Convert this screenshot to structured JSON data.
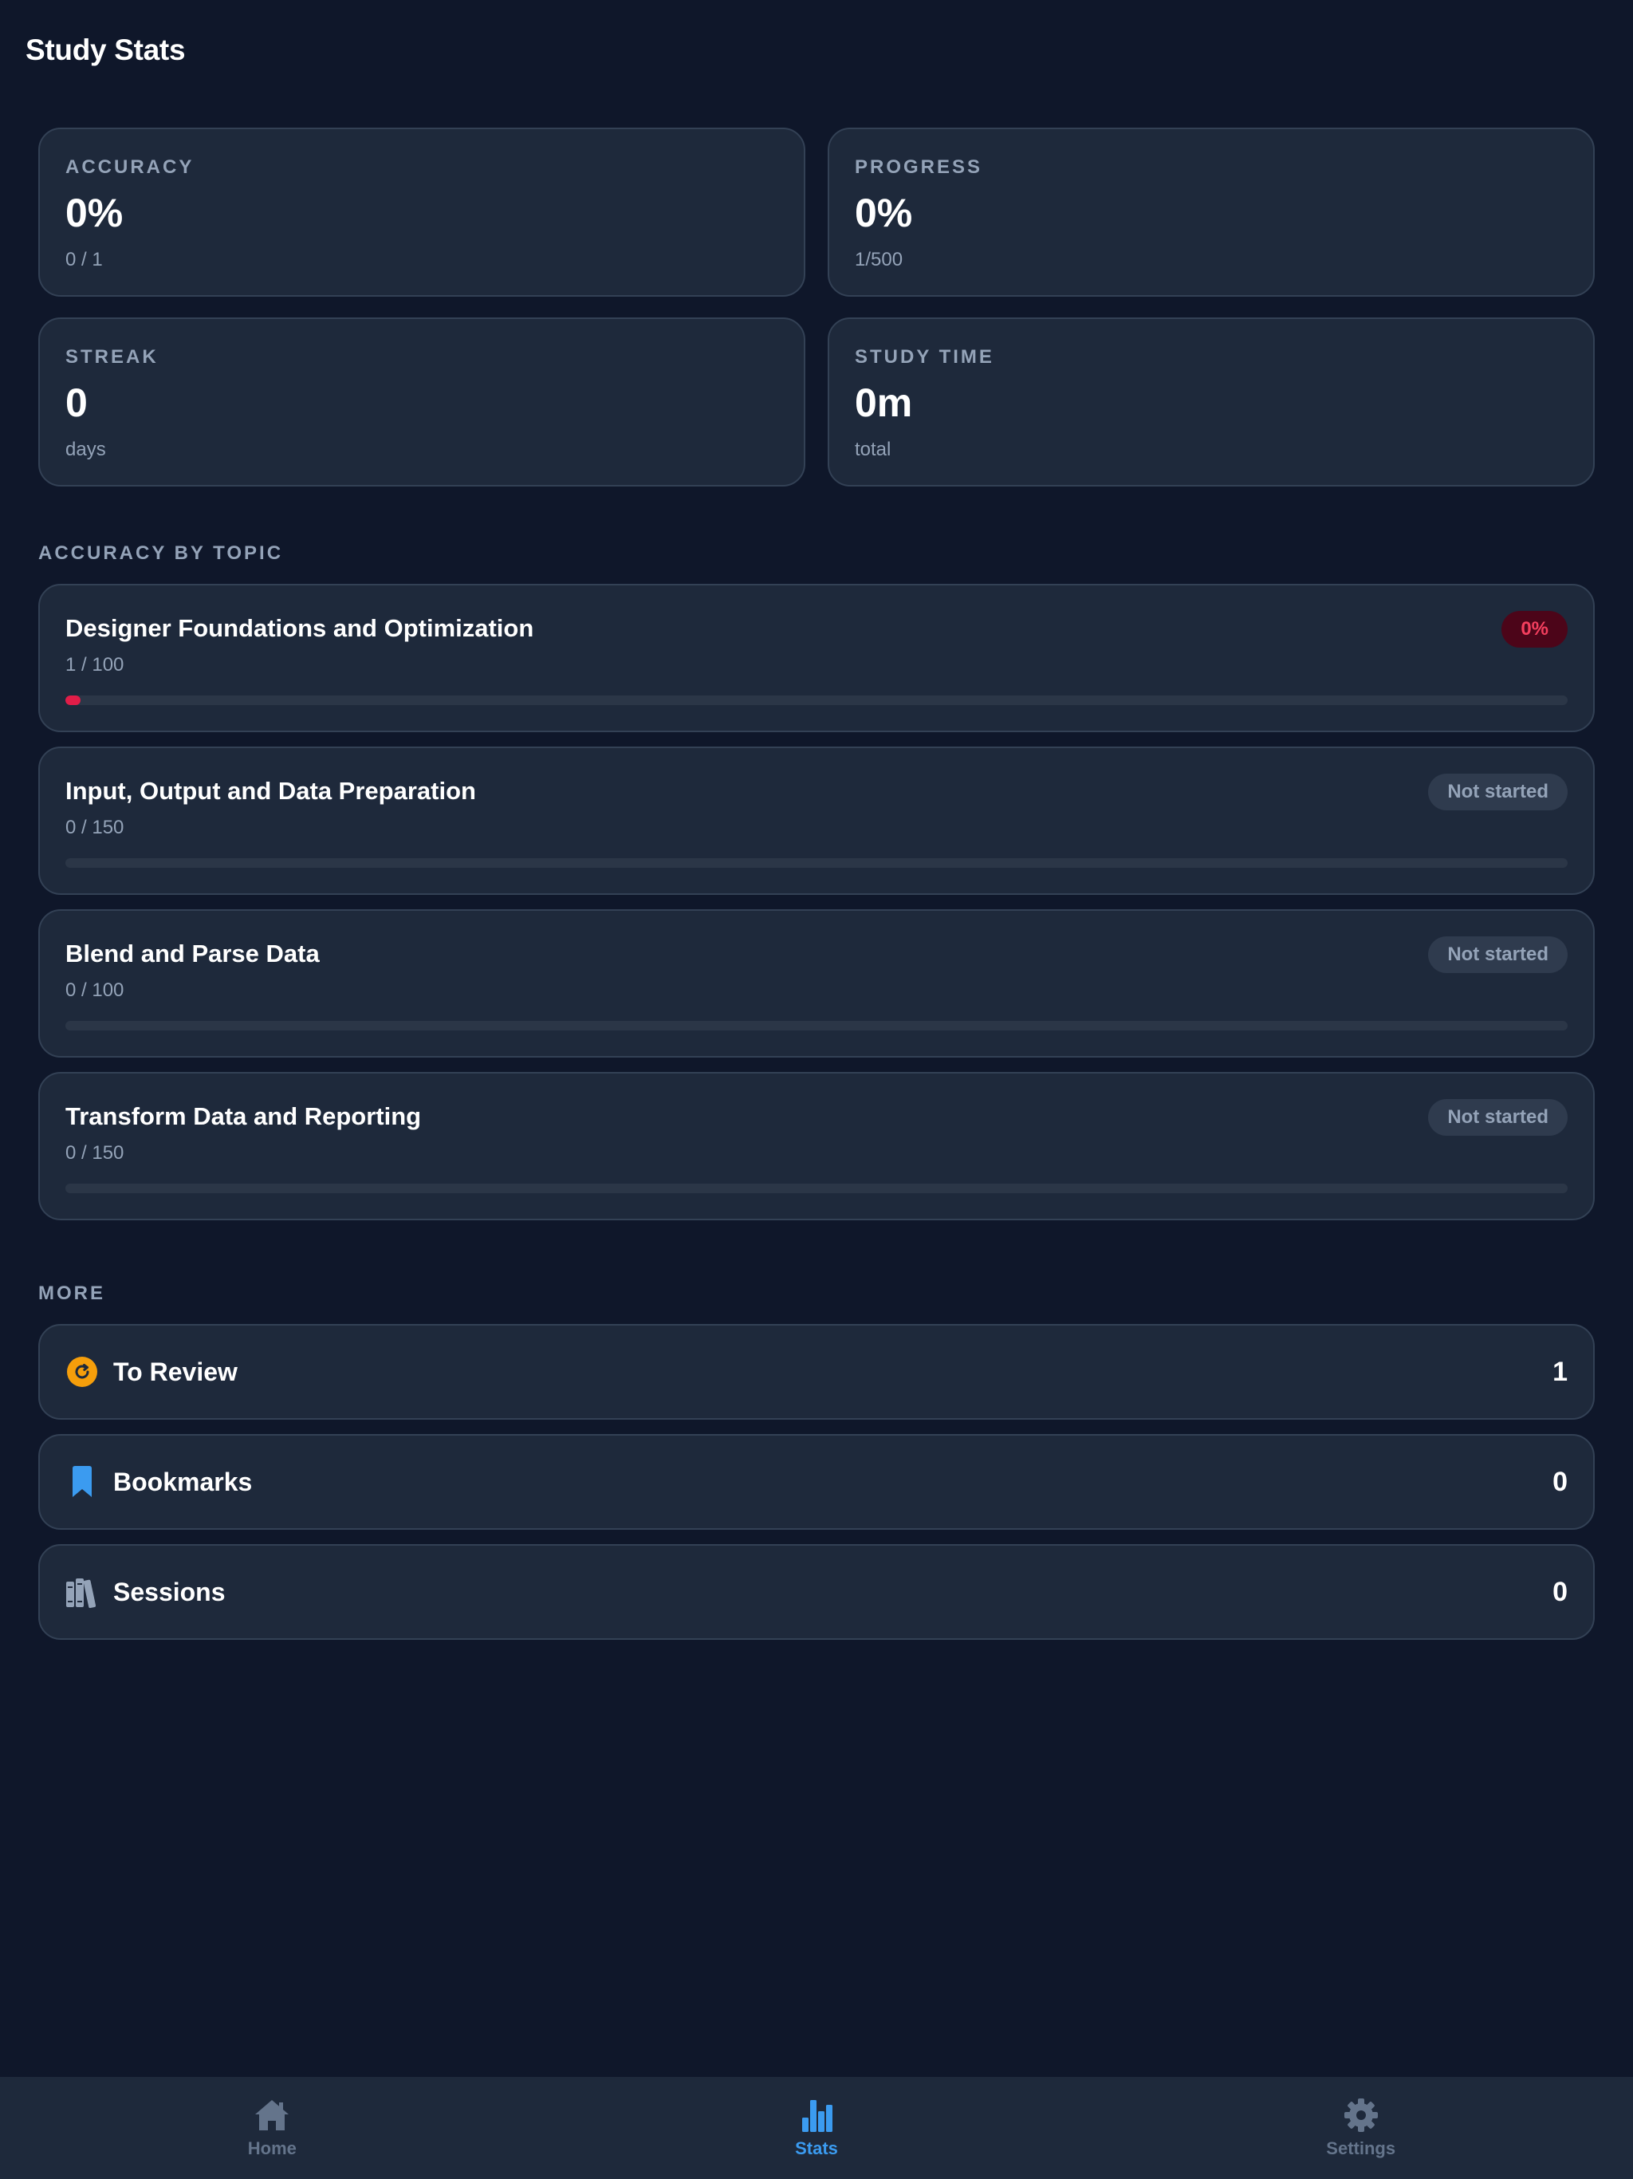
{
  "header": {
    "title": "Study Stats"
  },
  "stats": [
    {
      "label": "ACCURACY",
      "value": "0%",
      "sub": "0 / 1"
    },
    {
      "label": "PROGRESS",
      "value": "0%",
      "sub": "1/500"
    },
    {
      "label": "STREAK",
      "value": "0",
      "sub": "days"
    },
    {
      "label": "STUDY TIME",
      "value": "0m",
      "sub": "total"
    }
  ],
  "topics_section": {
    "title": "ACCURACY BY TOPIC",
    "items": [
      {
        "name": "Designer Foundations and Optimization",
        "count": "1 / 100",
        "badge": "0%",
        "progress": 0.01
      },
      {
        "name": "Input, Output and Data Preparation",
        "count": "0 / 150",
        "badge": "Not started",
        "progress": 0
      },
      {
        "name": "Blend and Parse Data",
        "count": "0 / 100",
        "badge": "Not started",
        "progress": 0
      },
      {
        "name": "Transform Data and Reporting",
        "count": "0 / 150",
        "badge": "Not started",
        "progress": 0
      }
    ]
  },
  "more_section": {
    "title": "MORE",
    "items": [
      {
        "label": "To Review",
        "count": "1",
        "icon": "refresh-icon"
      },
      {
        "label": "Bookmarks",
        "count": "0",
        "icon": "bookmark-icon"
      },
      {
        "label": "Sessions",
        "count": "0",
        "icon": "books-icon"
      }
    ]
  },
  "nav": {
    "items": [
      {
        "label": "Home",
        "icon": "home-icon",
        "active": false
      },
      {
        "label": "Stats",
        "icon": "bar-chart-icon",
        "active": true
      },
      {
        "label": "Settings",
        "icon": "gear-icon",
        "active": false
      }
    ]
  },
  "colors": {
    "background": "#0f172a",
    "card": "#1e293b",
    "accent": "#3b9bf0",
    "danger": "#e11d48",
    "review": "#f59e0b"
  }
}
